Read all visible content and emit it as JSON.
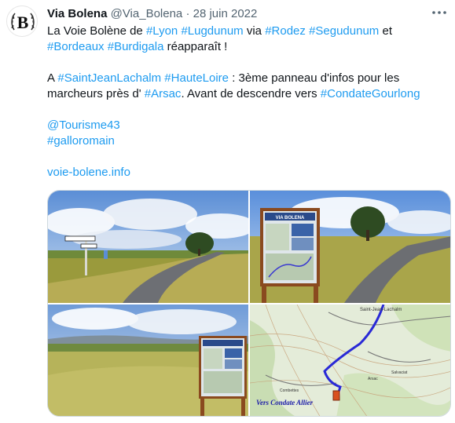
{
  "tweet": {
    "author_name": "Via Bolena",
    "author_handle": "@Via_Bolena",
    "separator": "·",
    "date": "28 juin 2022",
    "more_icon": "more-horizontal-icon",
    "avatar_letter": "B",
    "line1": {
      "t1": "La Voie Bolène de ",
      "h1": "#Lyon",
      "s1": " ",
      "h2": "#Lugdunum",
      "t2": " via ",
      "h3": "#Rodez",
      "s2": " ",
      "h4": "#Segudunum",
      "t3": " et"
    },
    "line2": {
      "h1": "#Bordeaux",
      "s1": " ",
      "h2": "#Burdigala",
      "t1": " réapparaît !"
    },
    "para2": {
      "t1": "A ",
      "h1": "#SaintJeanLachalm",
      "s1": " ",
      "h2": "#HauteLoire",
      "t2": " : 3ème panneau d'infos pour les marcheurs près d' ",
      "h3": "#Arsac",
      "t3": ". Avant de descendre vers ",
      "h4": "#CondateGourlong"
    },
    "mention": "@Tourisme43",
    "hashtag_last": "#galloromain",
    "url": "voie-bolene.info"
  },
  "media": {
    "sign_title": "VIA BOLENA",
    "map_label_top": "Saint-Jean-Lachalm",
    "map_label_a": "Combettes",
    "map_label_b": "Arsac",
    "map_label_c": "Salvaciat",
    "map_caption": "Vers Condate Allier"
  },
  "colors": {
    "link": "#1d9bf0",
    "muted": "#536471",
    "text": "#0f1419",
    "border": "#cfd9de"
  }
}
